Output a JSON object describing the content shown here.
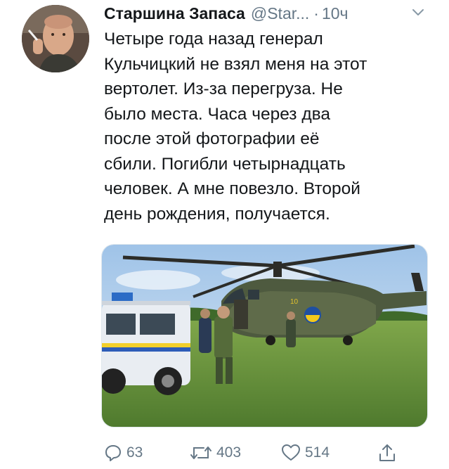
{
  "author": {
    "name": "Старшина Запаса",
    "handle": "@Star...",
    "separator": "·",
    "time": "10ч"
  },
  "tweet": {
    "lines": [
      "Четыре года назад генерал",
      "Кульчицкий не взял меня на этот",
      "вертолет. Из-за перегруза. Не",
      "было места. Часа через два",
      "после этой фотографии её",
      "сбили. Погибли четырнадцать",
      "человек. А мне повезло. Второй",
      "день рождения, получается."
    ]
  },
  "actions": {
    "reply_count": "63",
    "retweet_count": "403",
    "like_count": "514"
  },
  "icons": {
    "reply": "reply-icon",
    "retweet": "retweet-icon",
    "like": "heart-icon",
    "share": "share-icon",
    "menu": "chevron-down-icon"
  },
  "colors": {
    "text": "#14171a",
    "secondary": "#657786",
    "border": "#e1e8ed"
  }
}
